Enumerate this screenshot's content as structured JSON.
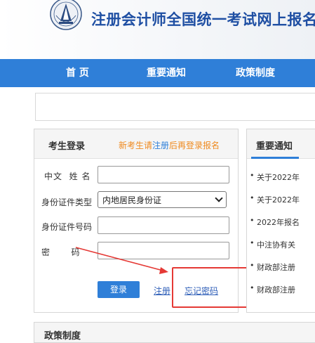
{
  "header": {
    "logo": "accounting-emblem-logo",
    "title": "注册会计师全国统一考试网上报名"
  },
  "nav": {
    "items": [
      {
        "label": "首 页"
      },
      {
        "label": "重要通知"
      },
      {
        "label": "政策制度"
      }
    ]
  },
  "login": {
    "title": "考生登录",
    "register_tip": {
      "prefix": "新考生请",
      "link": "注册",
      "suffix": "后再登录报名"
    },
    "fields": {
      "name_label": "中文  姓 名",
      "name_value": "",
      "id_type_label": "身份证件类型",
      "id_type_value": "内地居民身份证",
      "id_number_label": "身份证件号码",
      "id_number_value": "",
      "password_label": "密        码",
      "password_value": ""
    },
    "login_button": "登录",
    "register_link": "注册",
    "forgot_link": "忘记密码"
  },
  "news": {
    "title": "重要通知",
    "items": [
      "关于2022年",
      "关于2022年",
      "2022年报名",
      "中注协有关",
      "财政部注册",
      "财政部注册"
    ]
  },
  "policy": {
    "title": "政策制度"
  },
  "annotation": {
    "color": "#e53935"
  },
  "colors": {
    "primary": "#2f7fd8",
    "title": "#1f4fa3",
    "tip": "#ef8a1f"
  }
}
